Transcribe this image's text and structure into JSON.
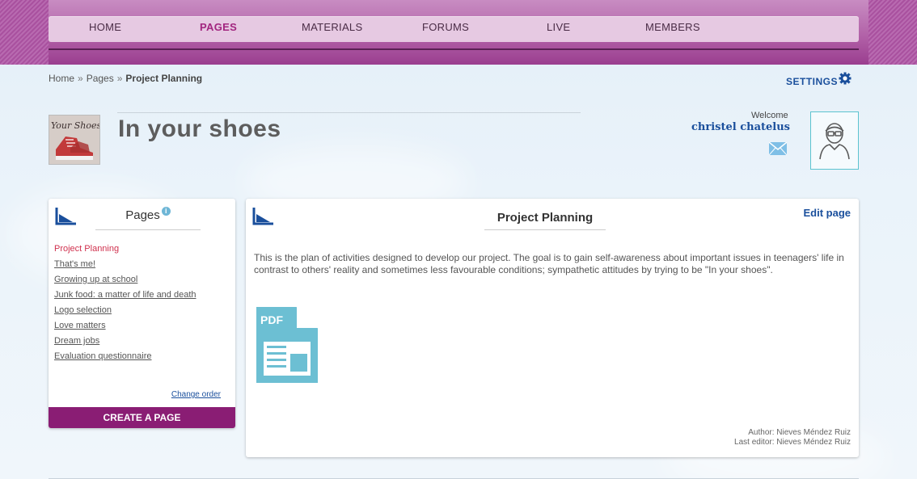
{
  "nav": {
    "items": [
      {
        "label": "HOME",
        "active": false
      },
      {
        "label": "PAGES",
        "active": true
      },
      {
        "label": "MATERIALS",
        "active": false
      },
      {
        "label": "FORUMS",
        "active": false
      },
      {
        "label": "LIVE",
        "active": false
      },
      {
        "label": "MEMBERS",
        "active": false
      }
    ]
  },
  "breadcrumb": {
    "home": "Home",
    "separator": "»",
    "pages": "Pages",
    "current": "Project Planning"
  },
  "settings": {
    "label": "SETTINGS",
    "icon": "gear-icon"
  },
  "group": {
    "title": "In your shoes",
    "logo_text": "Your Shoes"
  },
  "user": {
    "welcome": "Welcome",
    "name": "christel chatelus",
    "mail_icon": "mail-icon",
    "avatar_icon": "user-avatar-icon"
  },
  "sidebar": {
    "title": "Pages",
    "info_icon": "i",
    "items": [
      {
        "label": "Project Planning",
        "active": true
      },
      {
        "label": "That's me!",
        "active": false
      },
      {
        "label": "Growing up at school",
        "active": false
      },
      {
        "label": "Junk food: a matter of life and death",
        "active": false
      },
      {
        "label": "Logo selection",
        "active": false
      },
      {
        "label": "Love matters",
        "active": false
      },
      {
        "label": "Dream jobs",
        "active": false
      },
      {
        "label": "Evaluation questionnaire",
        "active": false
      }
    ],
    "change_order": "Change order",
    "create_button": "CREATE A PAGE"
  },
  "main": {
    "title": "Project Planning",
    "edit_label": "Edit page",
    "description": "This is the plan of activities designed to develop our project. The goal is to gain self-awareness about important issues in teenagers' life in contrast to others' reality and sometimes less favourable conditions; sympathetic attitudes by trying to be \"In your shoes\".",
    "attachment_label": "PDF",
    "author": "Author: Nieves Méndez Ruiz",
    "last_editor": "Last editor: Nieves Méndez Ruiz"
  },
  "colors": {
    "accent": "#a2257f",
    "link": "#1a4f9c",
    "active_page": "#d0314e",
    "button": "#8a1d74"
  }
}
